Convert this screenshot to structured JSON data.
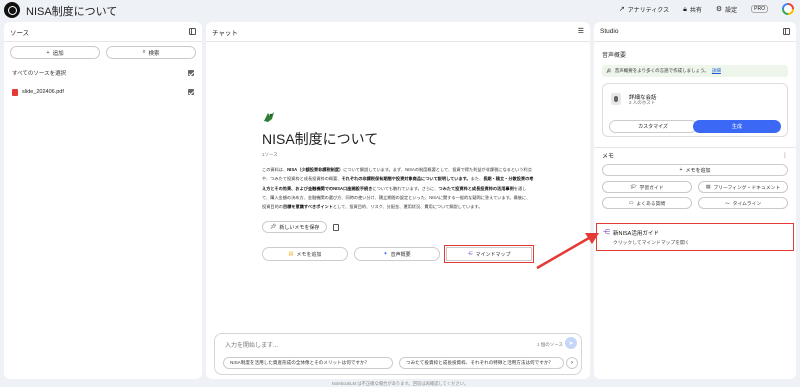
{
  "topbar": {
    "title": "NISA制度について",
    "analytics": "アナリティクス",
    "share": "共有",
    "settings": "設定",
    "pro": "PRO"
  },
  "sources": {
    "header": "ソース",
    "add": "追加",
    "search": "検索",
    "select_all": "すべてのソースを選択",
    "files": [
      {
        "name": "slide_202406.pdf"
      }
    ]
  },
  "chat": {
    "header": "チャット",
    "title": "NISA制度について",
    "source_count": "1ソース",
    "summary": {
      "p1": "この資料は、",
      "b1": "NISA（少額投資非課税制度）",
      "p2": "について解説しています。まず、NISAの制度概要として、投資で得た利益が非課税になるという利点や、つみたて投資枠と成長投資枠の概要、",
      "b2": "それぞれの非課税保有期間や投資対象商品について説明しています。",
      "p3": "また、",
      "b3": "長期・積立・分散投資の考え方とその効果、および金融機関でのNISA口座開設手続き",
      "p4": "についても触れています。さらに、",
      "b4": "つみたて投資枠と成長投資枠の活用事例",
      "p5": "を通して、購入金額の決め方、金融機関の選び方、同時の使い分け、積立期間の設定といった、NISAに関する一般的な疑問に答えています。最後に、投資目的の",
      "b5": "目標を意識すべきポイント",
      "p6": "として、投資目的、リスク、分配金、運用状況、費用について解説しています。"
    },
    "save_memo": "新しいメモを保存",
    "chips": [
      "メモを追加",
      "音声概要",
      "マインドマップ"
    ],
    "input_placeholder": "入力を開始します...",
    "input_source_count": "1 個のソース",
    "suggestions": [
      "NISA制度を活用した資産形成の全体像とそのメリットは何ですか？",
      "つみたて投資枠と成長投資枠、それぞれの特徴と活用方法は何ですか？"
    ]
  },
  "studio": {
    "header": "Studio",
    "audio_label": "音声概要",
    "banner_text": "音声概要をより多くの言語で作成しましょう。",
    "banner_link": "詳細",
    "audio_title": "詳細な会話",
    "audio_sub": "2 人のホスト",
    "customize": "カスタマイズ",
    "generate": "生成",
    "memo_label": "メモ",
    "add_memo": "メモを追加",
    "memo_buttons": [
      "学習ガイド",
      "ブリーフィング・ドキュメント",
      "よくある質問",
      "タイムライン"
    ],
    "note_title": "新NISA活用ガイド",
    "note_sub": "クリックしてマインドマップを開く"
  },
  "footer": "NotebookLM は不正確な場合があります。回答は再確認してください。"
}
